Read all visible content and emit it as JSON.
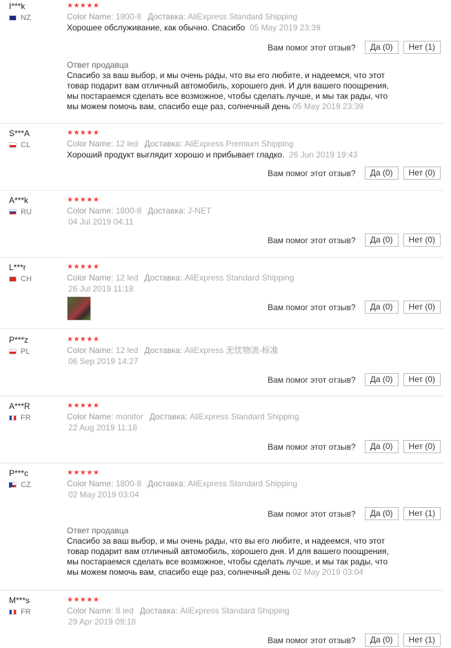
{
  "help_question": "Вам помог этот отзыв?",
  "yes_label": "Да",
  "no_label": "Нет",
  "color_label": "Color Name:",
  "delivery_label": "Доставка:",
  "reply_title": "Ответ продавца",
  "reply_text": "Спасибо за ваш выбор, и мы очень рады, что вы его любите, и надеемся, что этот товар подарит вам отличный автомобиль, хорошего дня. И для вашего поощрения, мы постараемся сделать все возможное, чтобы сделать лучше, и мы так рады, что мы можем помочь вам, спасибо еще раз, солнечный день",
  "reviews": [
    {
      "user": "I***k",
      "country": "NZ",
      "stars": "★★★★★",
      "color": "1800-8",
      "delivery": "AliExpress Standard Shipping",
      "text": "Хорошее обслуживание, как обычно. Спасибо",
      "date": "05 May 2019 23:39",
      "yes": "(0)",
      "no": "(1)",
      "reply_date": "05 May 2019 23:39"
    },
    {
      "user": "S***A",
      "country": "CL",
      "stars": "★★★★★",
      "color": "12 led",
      "delivery": "AliExpress Premium Shipping",
      "text": "Хороший продукт выглядит хорошо и прибывает гладко.",
      "date": "26 Jun 2019 19:43",
      "yes": "(0)",
      "no": "(0)"
    },
    {
      "user": "A***k",
      "country": "RU",
      "stars": "★★★★★",
      "color": "1800-8",
      "delivery": "J-NET",
      "date": "04 Jul 2019 04:11",
      "yes": "(0)",
      "no": "(0)"
    },
    {
      "user": "L***r",
      "country": "CH",
      "stars": "★★★★★",
      "color": "12 led",
      "delivery": "AliExpress Standard Shipping",
      "date": "26 Jul 2019 11:18",
      "yes": "(0)",
      "no": "(0)"
    },
    {
      "user": "P***z",
      "country": "PL",
      "stars": "★★★★★",
      "color": "12 led",
      "delivery": "AliExpress 无忧物流-标准",
      "date": "06 Sep 2019 14:27",
      "yes": "(0)",
      "no": "(0)"
    },
    {
      "user": "A***R",
      "country": "FR",
      "stars": "★★★★★",
      "color": "monitor",
      "delivery": "AliExpress Standard Shipping",
      "date": "22 Aug 2019 11:18",
      "yes": "(0)",
      "no": "(0)"
    },
    {
      "user": "P***c",
      "country": "CZ",
      "stars": "★★★★★",
      "color": "1800-8",
      "delivery": "AliExpress Standard Shipping",
      "date": "02 May 2019 03:04",
      "yes": "(0)",
      "no": "(1)",
      "reply_date": "02 May 2019 03:04"
    },
    {
      "user": "M***s",
      "country": "FR",
      "stars": "★★★★★",
      "color": "8 led",
      "delivery": "AliExpress Standard Shipping",
      "date": "29 Apr 2019 09:18",
      "yes": "(0)",
      "no": "(1)"
    }
  ]
}
